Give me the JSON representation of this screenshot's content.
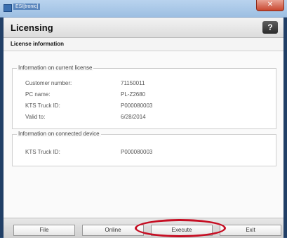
{
  "window": {
    "title": "ESI[tronic]"
  },
  "header": {
    "title": "Licensing",
    "help_label": "?"
  },
  "subheader": {
    "title": "License information"
  },
  "current_license": {
    "group_title": "Information on current license",
    "rows": [
      {
        "label": "Customer number:",
        "value": "71150011"
      },
      {
        "label": "PC name:",
        "value": "PL-Z2680"
      },
      {
        "label": "KTS Truck ID:",
        "value": "P000080003"
      },
      {
        "label": "Valid to:",
        "value": "6/28/2014"
      }
    ]
  },
  "connected_device": {
    "group_title": "Information on connected device",
    "rows": [
      {
        "label": "KTS Truck ID:",
        "value": "P000080003"
      }
    ]
  },
  "footer": {
    "buttons": [
      {
        "label": "File"
      },
      {
        "label": "Online"
      },
      {
        "label": "Execute"
      },
      {
        "label": "Exit"
      }
    ]
  },
  "colors": {
    "highlight": "#c60e23",
    "titlebar": "#9dbfe2"
  },
  "icons": {
    "app": "app-icon",
    "close": "close-icon",
    "help": "help-icon"
  }
}
